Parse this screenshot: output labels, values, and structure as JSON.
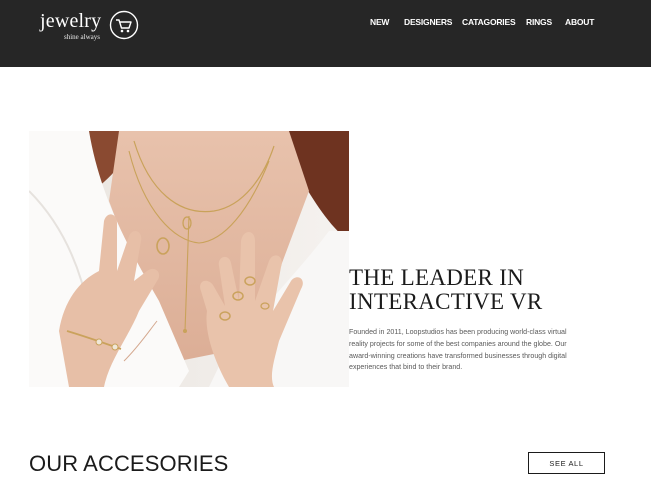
{
  "header": {
    "logo": {
      "word": "jewelry",
      "tagline": "shine always",
      "icon": "shopping-cart-icon"
    },
    "nav": [
      {
        "label": "NEW"
      },
      {
        "label": "DESIGNERS"
      },
      {
        "label": "CATAGORIES"
      },
      {
        "label": "RINGS"
      },
      {
        "label": "ABOUT"
      }
    ]
  },
  "hero": {
    "image": "woman-wearing-gold-necklaces-and-rings",
    "title_line1": "THE LEADER IN",
    "title_line2": "INTERACTIVE VR",
    "description": "Founded in 2011, Loopstudios has been producing world-class virtual reality projects for some of the best companies around the globe. Our award-winning creations have transformed businesses through digital experiences that bind to their brand."
  },
  "accessories": {
    "title": "OUR ACCESORIES",
    "see_all_label": "SEE ALL"
  },
  "colors": {
    "header_bg": "#262626",
    "text_dark": "#1b1b1b",
    "text_body": "#5a5a5a"
  }
}
